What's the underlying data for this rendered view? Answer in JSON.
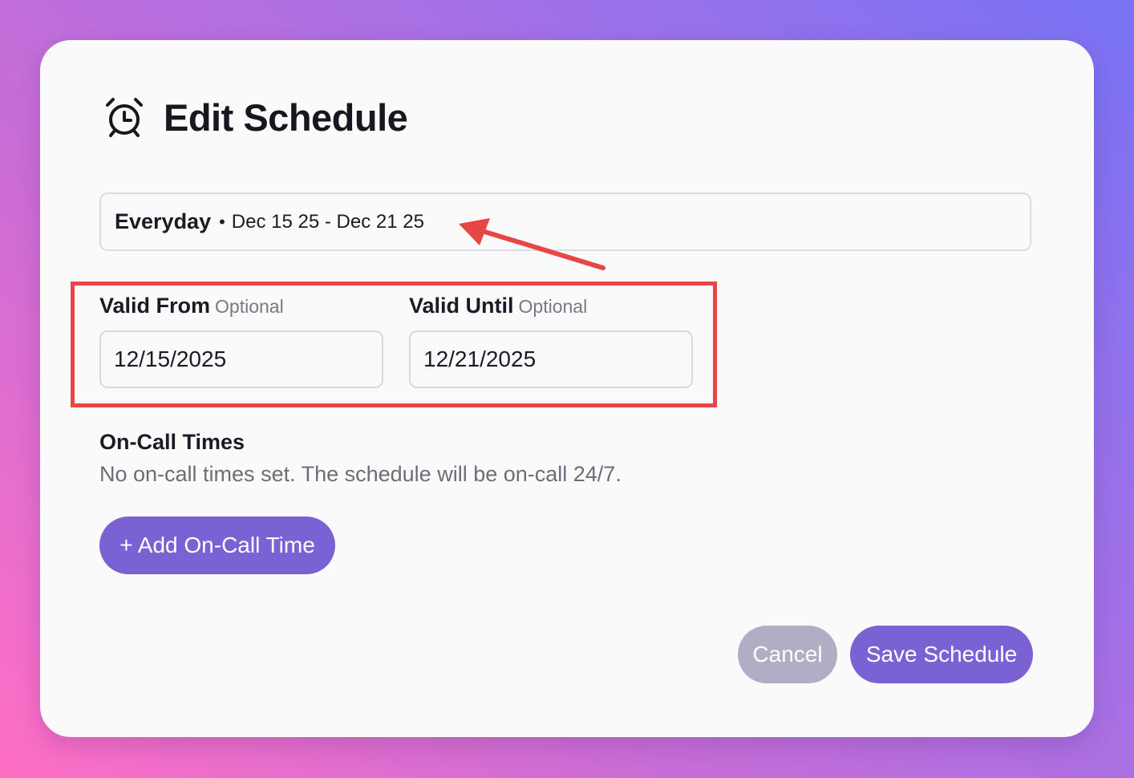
{
  "dialog": {
    "title": "Edit Schedule",
    "icon": "alarm-clock-icon"
  },
  "summary": {
    "label": "Everyday",
    "separator": "•",
    "range": "Dec 15 25 - Dec 21 25"
  },
  "fields": {
    "valid_from": {
      "label": "Valid From",
      "optional": "Optional",
      "value": "12/15/2025"
    },
    "valid_until": {
      "label": "Valid Until",
      "optional": "Optional",
      "value": "12/21/2025"
    }
  },
  "on_call": {
    "title": "On-Call Times",
    "description": "No on-call times set. The schedule will be on-call 24/7.",
    "add_label": "+ Add On-Call Time"
  },
  "actions": {
    "cancel_label": "Cancel",
    "save_label": "Save Schedule"
  },
  "colors": {
    "accent": "#7b62d4",
    "cancel": "#b0adc4",
    "annotation": "#e84545"
  }
}
